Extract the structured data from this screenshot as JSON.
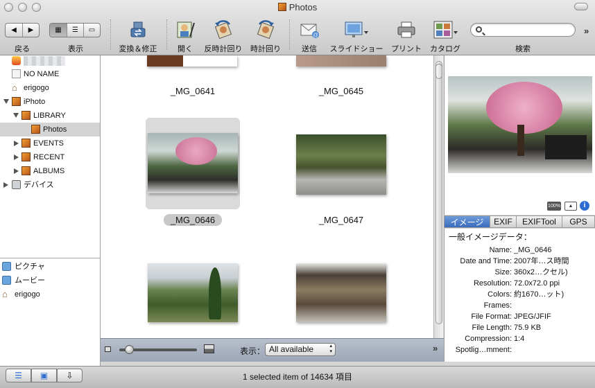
{
  "window": {
    "title": "Photos"
  },
  "toolbar": {
    "back_label": "戻る",
    "view_label": "表示",
    "convert_label": "変換＆修正",
    "open_label": "開く",
    "rotate_ccw_label": "反時計回り",
    "rotate_cw_label": "時計回り",
    "send_label": "送信",
    "slideshow_label": "スライドショー",
    "print_label": "プリント",
    "catalog_label": "カタログ",
    "search_label": "検索",
    "search_placeholder": ""
  },
  "sidebar": {
    "devices": [
      {
        "label": "",
        "blurred": true
      },
      {
        "label": "NO NAME"
      },
      {
        "label": "erigogo"
      },
      {
        "label": "iPhoto"
      },
      {
        "label": "LIBRARY"
      },
      {
        "label": "Photos",
        "selected": true
      },
      {
        "label": "EVENTS"
      },
      {
        "label": "RECENT"
      },
      {
        "label": "ALBUMS"
      },
      {
        "label": "デバイス"
      }
    ],
    "places": [
      {
        "label": "ピクチャ"
      },
      {
        "label": "ムービー"
      },
      {
        "label": "erigogo"
      }
    ]
  },
  "grid": {
    "items": [
      {
        "caption": "_MG_0641"
      },
      {
        "caption": "_MG_0645"
      },
      {
        "caption": "_MG_0646",
        "selected": true
      },
      {
        "caption": "_MG_0647"
      },
      {
        "caption": ""
      },
      {
        "caption": ""
      }
    ],
    "show_label": "表示：",
    "filter_value": "All available"
  },
  "preview": {
    "tabs": [
      "イメージ",
      "EXIF",
      "EXIFTool",
      "GPS"
    ],
    "active_tab": "イメージ",
    "section_title": "一般イメージデータ：",
    "zoom_badge": "100%",
    "fields": [
      {
        "key": "Name:",
        "value": "_MG_0646"
      },
      {
        "key": "Date and Time:",
        "value": "2007年…ス時間"
      },
      {
        "key": "Size:",
        "value": "360x2…クセル)"
      },
      {
        "key": "Resolution:",
        "value": "72.0x72.0 ppi"
      },
      {
        "key": "Colors:",
        "value": "約1670…ット)"
      },
      {
        "key": "Frames:",
        "value": ""
      },
      {
        "key": "File Format:",
        "value": "JPEG/JFIF"
      },
      {
        "key": "File Length:",
        "value": "75.9 KB"
      },
      {
        "key": "Compression:",
        "value": "1:4"
      },
      {
        "key": "Spotlig…mment:",
        "value": ""
      }
    ]
  },
  "status": {
    "text": "1 selected item of 14634 項目"
  }
}
